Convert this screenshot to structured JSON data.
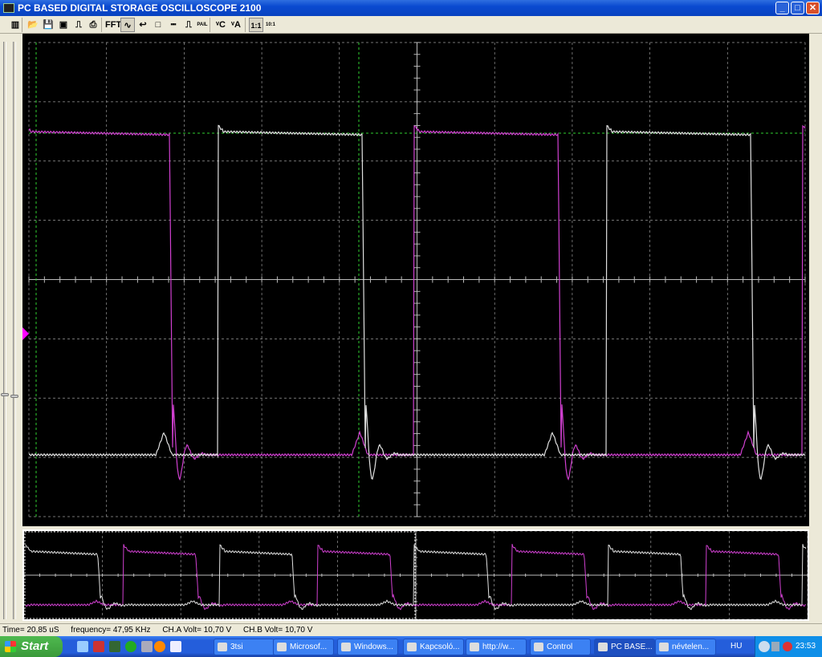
{
  "window": {
    "title": "PC BASED DIGITAL STORAGE OSCILLOSCOPE 2100",
    "minimize": "_",
    "maximize": "□",
    "close": "✕"
  },
  "toolbar": {
    "buttons": [
      {
        "name": "channel-icon",
        "label": "▥"
      },
      {
        "name": "open-folder-icon",
        "label": "📂"
      },
      {
        "name": "save-icon",
        "label": "💾"
      },
      {
        "name": "display-icon",
        "label": "▣"
      },
      {
        "name": "probe-icon",
        "label": "⎍"
      },
      {
        "name": "print-icon",
        "label": "⎙"
      },
      {
        "name": "fft-icon",
        "label": "FFT"
      },
      {
        "name": "waveform-icon",
        "label": "∿"
      },
      {
        "name": "undo-wave-icon",
        "label": "↩"
      },
      {
        "name": "cursor-box-icon",
        "label": "□"
      },
      {
        "name": "cursor-lines-icon",
        "label": "┅"
      },
      {
        "name": "pulse-icon",
        "label": "⎍"
      },
      {
        "name": "pass-fail-icon",
        "label": "PAIL SAFE"
      },
      {
        "name": "trigger-c-icon",
        "label": "ᵛC"
      },
      {
        "name": "trigger-a-icon",
        "label": "ᵛA"
      },
      {
        "name": "ratio-1-1",
        "label": "1:1"
      },
      {
        "name": "ratio-10-1",
        "label": "10:1"
      }
    ]
  },
  "colors": {
    "channel_a": "#e0e0e0",
    "channel_b": "#d040d0",
    "grid": "#9a9a9a",
    "cursor": "#30d030",
    "trigger_marker": "#ff00ff"
  },
  "status": {
    "time": "Time= 20,85 uS",
    "frequency": "frequency= 47,95 KHz",
    "cha_volt": "CH.A Volt= 10,70 V",
    "chb_volt": "CH.B Volt= 10,70 V"
  },
  "taskbar": {
    "start": "Start",
    "tasks": [
      "3tsi",
      "Microsof...",
      "Windows...",
      "Kapcsoló...",
      "http://w...",
      "Control",
      "PC BASE...",
      "névtelen..."
    ],
    "active_task": 6,
    "language": "HU",
    "clock": "23:53"
  }
}
